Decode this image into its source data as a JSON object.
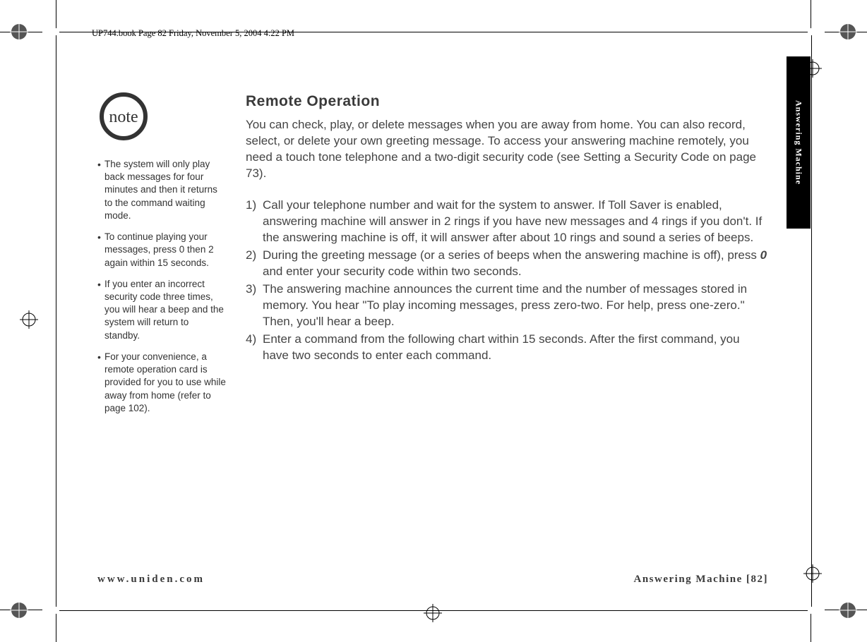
{
  "header": "UP744.book  Page 82  Friday, November 5, 2004  4:22 PM",
  "side_tab": "Answering Machine",
  "note_label": "note",
  "notes": [
    "The system will only play back messages for four minutes and then it returns to the command waiting mode.",
    "To continue playing your messages, press 0 then 2 again within 15 seconds.",
    "If you enter an incorrect security code three times, you will hear a beep and the system will return to standby.",
    "For your convenience, a remote operation card is provided for you to use while away from home (refer to page 102)."
  ],
  "main": {
    "title": "Remote Operation",
    "intro": "You can check, play, or delete messages when you are away from home. You can also record, select, or delete your own greeting message. To access your answering machine remotely, you need a touch tone telephone and a two-digit security code (see Setting a Security Code on page 73).",
    "steps": [
      "Call your telephone number and wait for the system to answer. If Toll Saver is enabled, answering machine will answer in 2 rings if you have new messages and 4 rings if you don't. If the answering machine is off, it will answer after about 10 rings and sound a series of beeps.",
      "During the greeting message (or a series of beeps when the answering machine is off), press {KEY0} and enter your security code within two seconds.",
      "The answering machine announces the current time and the number of messages stored in memory. You hear \"To play incoming messages, press zero-two. For help, press one-zero.\" Then, you'll hear a beep.",
      "Enter a command from the following chart within 15 seconds. After the first command, you have two seconds to enter each command."
    ],
    "key0": "0"
  },
  "footer": {
    "left": "www.uniden.com",
    "right": "Answering Machine [82]"
  }
}
